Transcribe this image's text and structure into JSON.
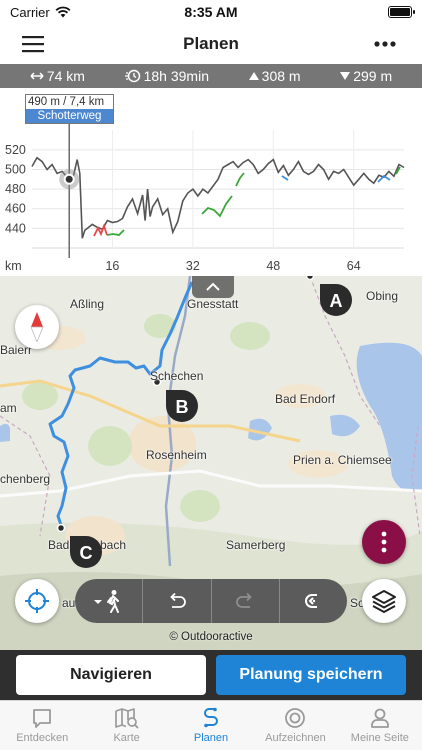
{
  "status_bar": {
    "carrier": "Carrier",
    "time": "8:35 AM"
  },
  "nav": {
    "title": "Planen"
  },
  "stats": {
    "distance": "74 km",
    "duration": "18h 39min",
    "ascent": "308 m",
    "descent": "299 m"
  },
  "profile": {
    "tooltip_value": "490 m / 7,4 km",
    "tooltip_surface": "Schotterweg",
    "x_unit": "km"
  },
  "chart_data": {
    "type": "line",
    "x_unit": "km",
    "y_unit": "m",
    "xlim": [
      0,
      74
    ],
    "ylim": [
      420,
      530
    ],
    "x_ticks": [
      16,
      32,
      48,
      64
    ],
    "y_ticks": [
      440,
      460,
      480,
      500,
      520
    ],
    "grid": true,
    "marker_x": 7.4,
    "marker_y": 490,
    "x": [
      0,
      1,
      2,
      3,
      4,
      5,
      6,
      7,
      7.4,
      8,
      9,
      9.5,
      10,
      10.5,
      11,
      12,
      13,
      14,
      15,
      16,
      17,
      18,
      19,
      20,
      21,
      22,
      22.5,
      23,
      23.5,
      24,
      25,
      26,
      27,
      28,
      29,
      30,
      31,
      32,
      33,
      34,
      35,
      36,
      37,
      38,
      39,
      40,
      41,
      42,
      43,
      44,
      45,
      46,
      47,
      48,
      49,
      50,
      51,
      52,
      53,
      54,
      55,
      56,
      57,
      58,
      59,
      60,
      61,
      62,
      63,
      64,
      65,
      66,
      67,
      68,
      69,
      70,
      71,
      72,
      73,
      74
    ],
    "y": [
      503,
      512,
      508,
      500,
      505,
      496,
      498,
      492,
      490,
      488,
      510,
      496,
      430,
      438,
      440,
      444,
      441,
      439,
      448,
      446,
      447,
      450,
      462,
      470,
      455,
      474,
      448,
      480,
      452,
      462,
      470,
      454,
      460,
      436,
      447,
      468,
      476,
      480,
      473,
      480,
      476,
      483,
      490,
      502,
      505,
      508,
      502,
      507,
      510,
      505,
      496,
      500,
      506,
      510,
      497,
      504,
      494,
      500,
      508,
      498,
      495,
      498,
      505,
      500,
      490,
      498,
      496,
      500,
      492,
      484,
      490,
      496,
      490,
      486,
      494,
      492,
      498,
      493,
      505,
      502
    ]
  },
  "map": {
    "places": [
      "Aßling",
      "Gnesstatt",
      "Obing",
      "Baierr",
      "Schechen",
      "Bad Endorf",
      "am",
      "Rosenheim",
      "Prien a. Chiemsee",
      "chenberg",
      "Bad",
      "bach",
      "Samerberg",
      "au",
      "Sc"
    ],
    "markers": [
      "A",
      "B",
      "C"
    ],
    "attribution": "© Outdooractive",
    "route_color": "#3f8fe0",
    "marker_color": "#2b2b2b"
  },
  "actions": {
    "navigate": "Navigieren",
    "save": "Planung speichern"
  },
  "tabs": [
    {
      "label": "Entdecken",
      "icon": "speech-bubble-icon",
      "active": false
    },
    {
      "label": "Karte",
      "icon": "map-search-icon",
      "active": false
    },
    {
      "label": "Planen",
      "icon": "route-planning-icon",
      "active": true
    },
    {
      "label": "Aufzeichnen",
      "icon": "record-icon",
      "active": false
    },
    {
      "label": "Meine Seite",
      "icon": "user-icon",
      "active": false
    }
  ],
  "colors": {
    "accent": "#1f84d6",
    "fab": "#8a0f47",
    "stats_bg": "#767676",
    "actions_bg": "#2f2f2f"
  }
}
